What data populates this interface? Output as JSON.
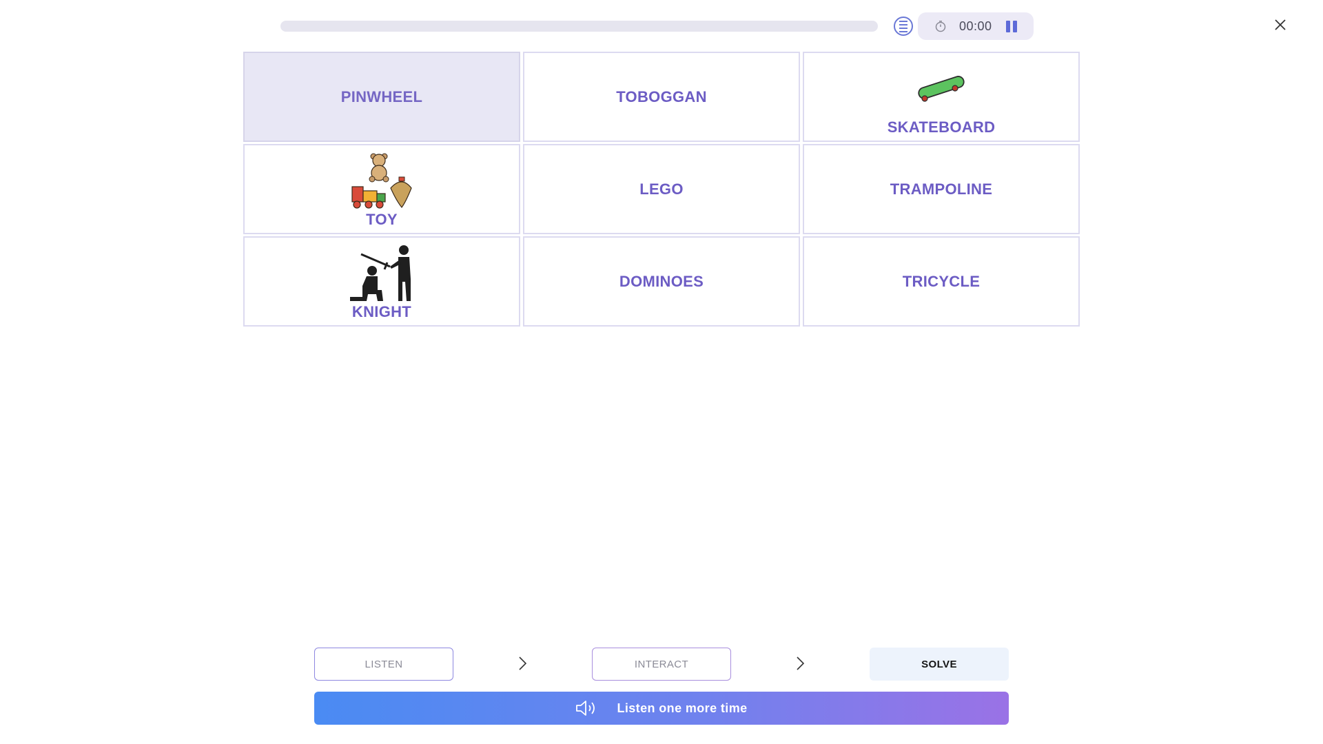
{
  "header": {
    "timer": "00:00",
    "progress": 0
  },
  "grid": {
    "cells": [
      {
        "label": "PINWHEEL",
        "selected": true,
        "image": null
      },
      {
        "label": "TOBOGGAN",
        "selected": false,
        "image": null
      },
      {
        "label": "SKATEBOARD",
        "selected": false,
        "image": "skateboard-icon"
      },
      {
        "label": "TOY",
        "selected": false,
        "image": "toys-icon"
      },
      {
        "label": "LEGO",
        "selected": false,
        "image": null
      },
      {
        "label": "TRAMPOLINE",
        "selected": false,
        "image": null
      },
      {
        "label": "KNIGHT",
        "selected": false,
        "image": "knighting-icon"
      },
      {
        "label": "DOMINOES",
        "selected": false,
        "image": null
      },
      {
        "label": "TRICYCLE",
        "selected": false,
        "image": null
      }
    ]
  },
  "steps": {
    "listen": "LISTEN",
    "interact": "INTERACT",
    "solve": "SOLVE"
  },
  "listen_button": {
    "label": "Listen one more time"
  },
  "colors": {
    "accent": "#6c5cc4",
    "progress_track": "#e6e5ef",
    "gradient_start": "#4a8bf3",
    "gradient_end": "#9a72e6"
  }
}
